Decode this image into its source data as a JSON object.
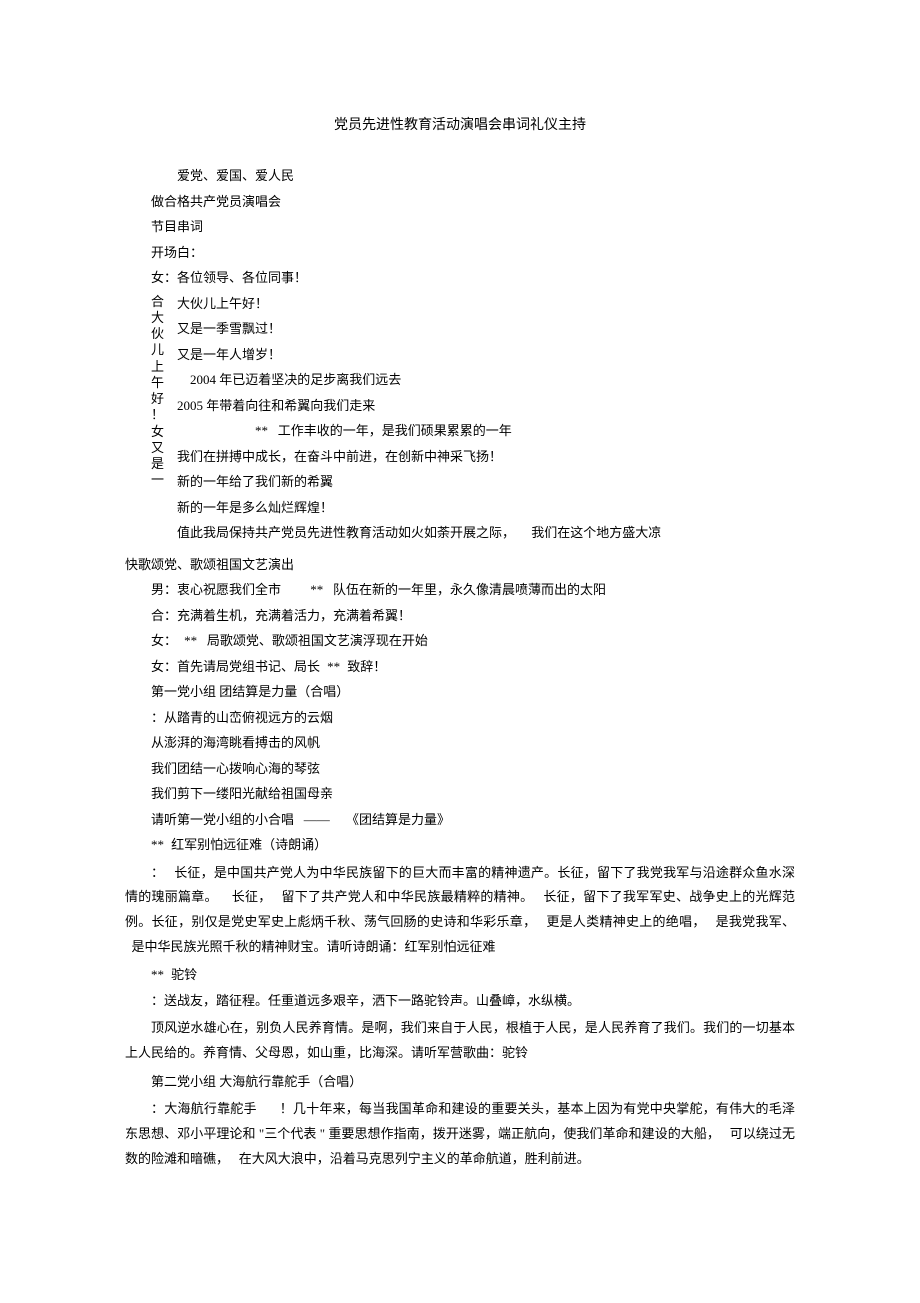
{
  "title": "党员先进性教育活动演唱会串词礼仪主持",
  "subtitle_line": "爱党、爱国、爱人民",
  "lines": {
    "l1": "做合格共产党员演唱会",
    "l2": "节目串词",
    "l3": "开场白：",
    "l4": "女：各位领导、各位同事！",
    "l5": "大伙儿上午好！",
    "l6": "又是一季雪飘过！",
    "l7": "又是一年人增岁！"
  },
  "vert1": {
    "c1": "合",
    "c2": "大",
    "c3": "伙",
    "c4": "儿",
    "c5": "上",
    "c6": "午",
    "c7": "好",
    "c8": "！",
    "c9": "女",
    "c10": "又",
    "c11": "是",
    "c12": "一"
  },
  "side": {
    "s1": "2004 年已迈着坚决的足步离我们远去",
    "s2": "2005 年带着向往和希翼向我们走来",
    "s3a": "**",
    "s3b": "工作丰收的一年，是我们硕果累累的一年",
    "s4": "我们在拼搏中成长，在奋斗中前进，在创新中神采飞扬！",
    "s5": "新的一年给了我们新的希翼",
    "s6": "新的一年是多么灿烂辉煌！",
    "s7a": "值此我局保持共产党员先进性教育活动如火如荼开展之际，",
    "s7b": "我们在这个地方盛大凉"
  },
  "body": {
    "b1": "快歌颂党、歌颂祖国文艺演出",
    "b2a": "男：衷心祝愿我们全市",
    "b2b": "**",
    "b2c": "队伍在新的一年里，永久像清晨喷薄而出的太阳",
    "b3": "合：充满着生机，充满着活力，充满着希翼！",
    "b4a": "女：",
    "b4b": "**",
    "b4c": "局歌颂党、歌颂祖国文艺演浮现在开始",
    "b5a": "女：首先请局党组书记、局长",
    "b5b": "**",
    "b5c": "致辞！",
    "b6": "第一党小组 团结算是力量（合唱）",
    "b7": "：从踏青的山峦俯视远方的云烟",
    "b8": "从澎湃的海湾眺看搏击的风帆",
    "b9": "我们团结一心拨响心海的琴弦",
    "b10": "我们剪下一缕阳光献给祖国母亲",
    "b11a": "请听第一党小组的小合唱",
    "b11b": "——",
    "b11c": "《团结算是力量》",
    "b12a": "**",
    "b12b": "红军别怕远征难（诗朗诵）",
    "b13a": "：",
    "b13b": "长征，是中国共产党人为中华民族留下的巨大而丰富的精神遗产。长征，留下了我党我军与沿途群众鱼水深情的瑰丽篇章。",
    "b13c": "长征，",
    "b13d": "留下了共产党人和中华民族最精粹的精神。",
    "b13e": "长征，留下了我军军史、战争史上的光辉范例。长征，别仅是党史军史上彪炳千秋、荡气回肠的史诗和华彩乐章，",
    "b13f": "更是人类精神史上的绝唱，",
    "b13g": "是我党我军、",
    "b13h": "是中华民族光照千秋的精神财宝。请听诗朗诵：红军别怕远征难",
    "b14a": "**",
    "b14b": "驼铃",
    "b15": "：送战友，踏征程。任重道远多艰辛，洒下一路驼铃声。山叠嶂，水纵横。",
    "b16": "顶风逆水雄心在，别负人民养育情。是啊，我们来自于人民，根植于人民，是人民养育了我们。我们的一切基本上人民给的。养育情、父母恩，如山重，比海深。请听军营歌曲：驼铃",
    "b17": "第二党小组 大海航行靠舵手（合唱）",
    "b18a": "：大海航行靠舵手",
    "b18b": "！几十年来，每当我国革命和建设的重要关头，基本上因为有党中央掌舵，有伟大的毛泽东思想、邓小平理论和",
    "b18c": "\"三个代表",
    "b18d": "\" 重要思想作指南，拨开迷雾，端正航向，使我们革命和建设的大船，",
    "b18e": "可以绕过无数的险滩和暗礁，",
    "b18f": "在大风大浪中，沿着马克思列宁主义的革命航道，胜利前进。"
  }
}
